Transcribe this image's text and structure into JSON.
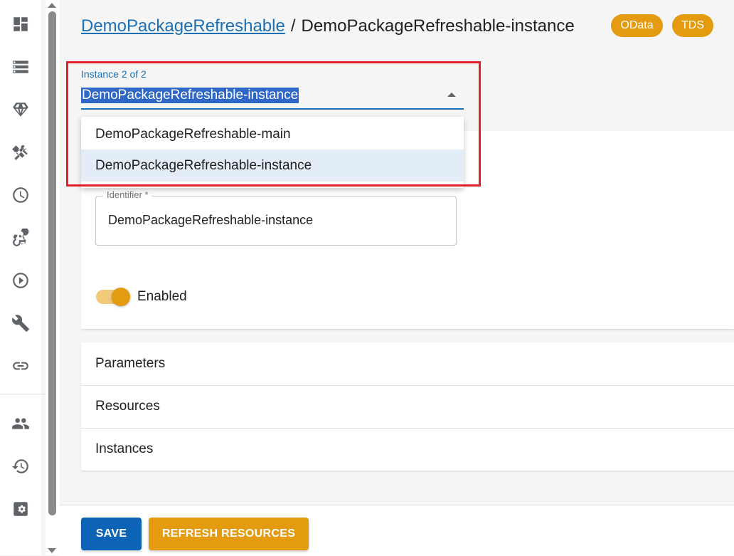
{
  "header": {
    "parent_link": "DemoPackageRefreshable",
    "separator": "/",
    "current": "DemoPackageRefreshable-instance",
    "badges": [
      "OData",
      "TDS"
    ]
  },
  "instance_select": {
    "label": "Instance 2 of 2",
    "value": "DemoPackageRefreshable-instance",
    "options": [
      "DemoPackageRefreshable-main",
      "DemoPackageRefreshable-instance"
    ],
    "selected_index": 1
  },
  "form": {
    "identifier_label": "Identifier *",
    "identifier_value": "DemoPackageRefreshable-instance",
    "enabled_label": "Enabled",
    "enabled": true
  },
  "sections": [
    "Parameters",
    "Resources",
    "Instances"
  ],
  "actions": {
    "save_label": "SAVE",
    "refresh_label": "REFRESH RESOURCES"
  },
  "sidebar": {
    "icons": [
      "dashboard-icon",
      "list-icon",
      "diamond-icon",
      "tools-icon",
      "clock-icon",
      "webhook-icon",
      "play-circle-icon",
      "wrench-icon",
      "link-icon",
      "users-icon",
      "history-icon",
      "settings-icon"
    ]
  },
  "colors": {
    "primary": "#1a6fb5",
    "accent": "#e49b0f",
    "highlight": "#e0202b"
  }
}
